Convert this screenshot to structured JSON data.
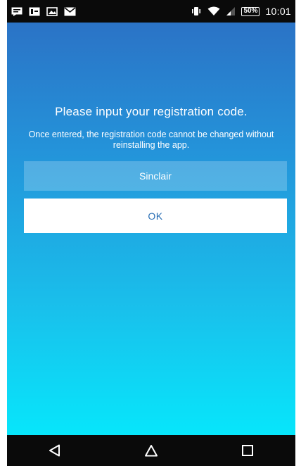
{
  "status_bar": {
    "left_icons": [
      "message-icon",
      "image-icon",
      "gallery-icon",
      "mail-icon"
    ],
    "right_icons": [
      "vibrate-icon",
      "wifi-icon",
      "signal-icon"
    ],
    "battery_text": "50%",
    "time": "10:01"
  },
  "dialog": {
    "title": "Please input your registration code.",
    "note": "Once entered, the registration code cannot be changed without reinstalling the app.",
    "code_value": "Sinclair",
    "ok_label": "OK"
  },
  "nav_bar": {
    "buttons": [
      "back-icon",
      "home-icon",
      "recents-icon"
    ]
  },
  "colors": {
    "gradient_top": "#2b73c6",
    "gradient_bottom": "#07e6fb",
    "ok_text": "#2a6fb5"
  }
}
